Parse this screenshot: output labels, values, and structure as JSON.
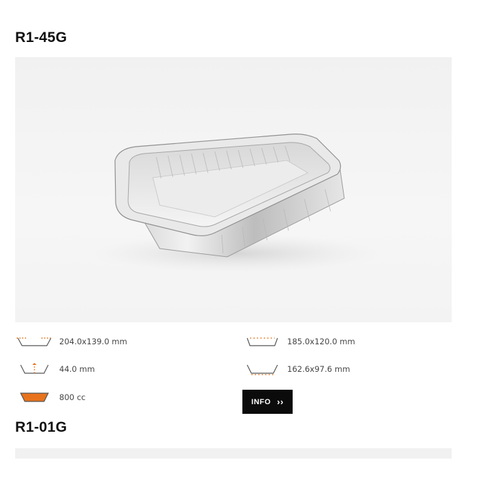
{
  "products": [
    {
      "code": "R1-45G",
      "image_alt": "aluminium foil tray",
      "specs": {
        "top_dimensions": "204.0x139.0 mm",
        "height": "44.0 mm",
        "capacity": "800 cc",
        "inner_top_dimensions": "185.0x120.0 mm",
        "bottom_dimensions": "162.6x97.6 mm"
      },
      "info_label": "INFO",
      "info_chevron": "››"
    },
    {
      "code": "R1-01G"
    }
  ],
  "colors": {
    "accent": "#e8731c",
    "button_bg": "#0b0b0b",
    "icon_stroke": "#555555"
  },
  "icons": {
    "top_dimensions": "tray-top-dimensions-icon",
    "height": "tray-height-icon",
    "capacity": "tray-capacity-icon",
    "inner_top_dimensions": "tray-inner-top-icon",
    "bottom_dimensions": "tray-bottom-dimensions-icon"
  }
}
